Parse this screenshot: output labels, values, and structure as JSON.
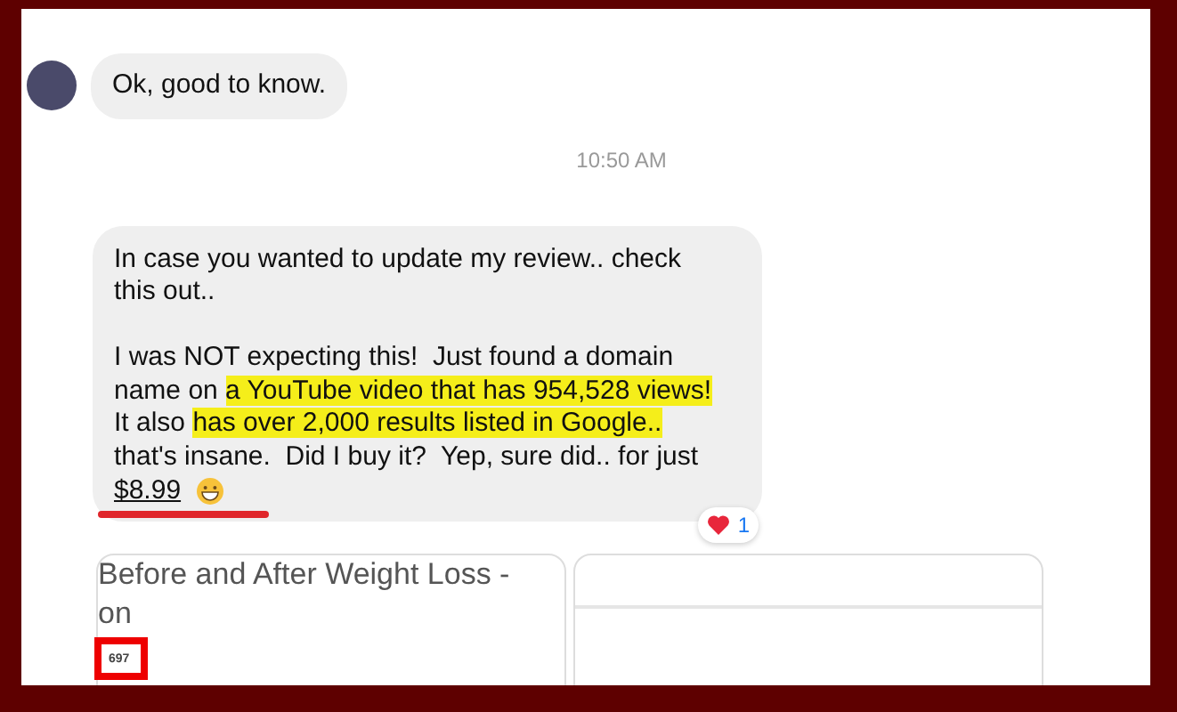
{
  "messages": [
    {
      "kind": "short",
      "text": "Ok, good to know."
    },
    {
      "kind": "time",
      "text": "10:50 AM"
    },
    {
      "kind": "long",
      "paragraphs": [
        [
          [
            {
              "text": "In case you wanted to update my review.. check",
              "highlight": false
            }
          ],
          [
            {
              "text": "this out..",
              "highlight": false
            }
          ]
        ],
        [
          [
            {
              "text": "I was NOT expecting this!  Just found a domain",
              "highlight": false
            }
          ],
          [
            {
              "text": "name on ",
              "highlight": false
            },
            {
              "text": "a YouTube video that has 954,528 views!",
              "highlight": true
            }
          ],
          [
            {
              "text": "It also ",
              "highlight": false
            },
            {
              "text": "has over 2,000 results listed in Google..",
              "highlight": true
            }
          ],
          [
            {
              "text": "that's insane.  Did I buy it?  Yep, sure did.. for just",
              "highlight": false
            }
          ]
        ]
      ],
      "price": "$8.99",
      "reaction_count": "1"
    }
  ],
  "link_previews": [
    {
      "title": "Before and After Weight Loss - on",
      "count": "697",
      "kind": "titled"
    },
    {
      "kind": "empty"
    }
  ]
}
